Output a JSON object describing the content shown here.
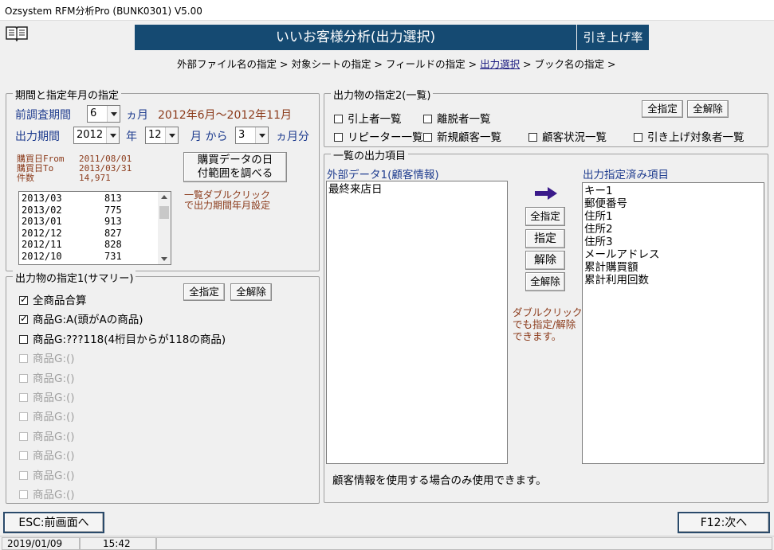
{
  "window": {
    "title": "Ozsystem RFM分析Pro (BUNK0301)   V5.00"
  },
  "header": {
    "title": "いいお客様分析(出力選択)",
    "side_label": "引き上げ率"
  },
  "breadcrumb": {
    "step1": "外部ファイル名の指定 >",
    "step2": "対象シートの指定 >",
    "step3": "フィールドの指定 >",
    "step4": "出力選択",
    "step5": "> ブック名の指定 >"
  },
  "period": {
    "group_title": "期間と指定年月の指定",
    "survey_label": "前調査期間",
    "survey_value": "6",
    "survey_unit": "ヵ月",
    "survey_range": "2012年6月～2012年11月",
    "output_label": "出力期間",
    "year_value": "2012",
    "year_unit": "年",
    "month_value": "12",
    "month_from": "月 から",
    "count_value": "3",
    "count_unit": "ヵ月分",
    "info_from_label": "購買日From",
    "info_from_value": "2011/08/01",
    "info_to_label": "購買日To",
    "info_to_value": "2013/03/31",
    "info_count_label": "件数",
    "info_count_value": "14,971",
    "check_button_line1": "購買データの日",
    "check_button_line2": "付範囲を調べる",
    "hint": "一覧ダブルクリックで出力期間年月設定",
    "list": [
      {
        "month": "2013/03",
        "count": "813"
      },
      {
        "month": "2013/02",
        "count": "775"
      },
      {
        "month": "2013/01",
        "count": "913"
      },
      {
        "month": "2012/12",
        "count": "827"
      },
      {
        "month": "2012/11",
        "count": "828"
      },
      {
        "month": "2012/10",
        "count": "731"
      }
    ]
  },
  "summary": {
    "group_title": "出力物の指定1(サマリー)",
    "select_all": "全指定",
    "clear_all": "全解除",
    "items": [
      {
        "label": "全商品合算",
        "checked": true,
        "disabled": false
      },
      {
        "label": "商品G:A(頭がAの商品)",
        "checked": true,
        "disabled": false
      },
      {
        "label": "商品G:???118(4桁目からが118の商品)",
        "checked": false,
        "disabled": false
      },
      {
        "label": "商品G:()",
        "checked": false,
        "disabled": true
      },
      {
        "label": "商品G:()",
        "checked": false,
        "disabled": true
      },
      {
        "label": "商品G:()",
        "checked": false,
        "disabled": true
      },
      {
        "label": "商品G:()",
        "checked": false,
        "disabled": true
      },
      {
        "label": "商品G:()",
        "checked": false,
        "disabled": true
      },
      {
        "label": "商品G:()",
        "checked": false,
        "disabled": true
      },
      {
        "label": "商品G:()",
        "checked": false,
        "disabled": true
      },
      {
        "label": "商品G:()",
        "checked": false,
        "disabled": true
      }
    ]
  },
  "listing": {
    "group_title": "出力物の指定2(一覧)",
    "select_all": "全指定",
    "clear_all": "全解除",
    "items": [
      "引上者一覧",
      "離脱者一覧",
      "リピーター一覧",
      "新規顧客一覧",
      "顧客状況一覧",
      "引き上げ対象者一覧"
    ]
  },
  "columns": {
    "group_title": "一覧の出力項目",
    "left_title": "外部データ1(顧客情報)",
    "left_items": [
      "最終来店日"
    ],
    "right_title": "出力指定済み項目",
    "right_items": [
      "キー1",
      "郵便番号",
      "住所1",
      "住所2",
      "住所3",
      "メールアドレス",
      "累計購買額",
      "累計利用回数"
    ],
    "btn_select_all": "全指定",
    "btn_select": "指定",
    "btn_remove": "解除",
    "btn_remove_all": "全解除",
    "hint": "ダブルクリックでも指定/解除できます。",
    "note": "顧客情報を使用する場合のみ使用できます。",
    "arrow_icon": "right-arrow-icon"
  },
  "footer": {
    "back": "ESC:前画面へ",
    "next": "F12:次へ"
  },
  "status": {
    "date": "2019/01/09",
    "time": "15:42"
  },
  "colors": {
    "header": "#154a72",
    "blue_text": "#1f3d8f",
    "brown_text": "#8b3a1a",
    "arrow": "#3a1a8a"
  }
}
